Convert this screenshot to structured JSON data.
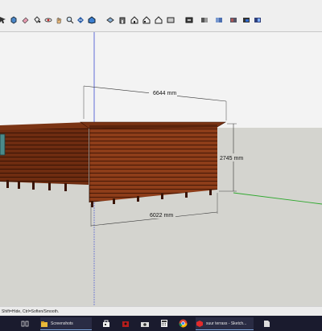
{
  "toolbar": {
    "buttons": [
      {
        "icon": "select-arrow-icon"
      },
      {
        "icon": "component-icon"
      },
      {
        "icon": "eraser-icon"
      },
      {
        "icon": "paint-bucket-icon"
      },
      {
        "icon": "orbit-icon"
      },
      {
        "icon": "pan-icon"
      },
      {
        "icon": "zoom-icon"
      },
      {
        "icon": "zoom-extents-icon"
      },
      {
        "icon": "iso-view-icon"
      },
      {
        "icon": "top-view-icon"
      },
      {
        "icon": "front-view-icon"
      },
      {
        "icon": "right-view-icon"
      },
      {
        "icon": "back-view-icon"
      },
      {
        "icon": "left-view-icon"
      },
      {
        "icon": "xray-icon"
      },
      {
        "icon": "wireframe-icon"
      },
      {
        "icon": "hidden-line-icon"
      },
      {
        "icon": "shaded-icon"
      },
      {
        "icon": "shaded-texture-icon"
      },
      {
        "icon": "monochrome-icon"
      }
    ]
  },
  "viewport": {
    "dimensions": {
      "top_width": "6644 mm",
      "height": "2745 mm",
      "bottom_width": "6022 mm"
    },
    "colors": {
      "sky": "#f3f3f3",
      "ground": "#d4d4cf",
      "wood": "#8a3a18",
      "roof": "#7a3414",
      "axis_blue": "#3a4bd0",
      "axis_green": "#2ea82e"
    }
  },
  "status_bar": {
    "text": "Shift=Hide, Ctrl=Soften/Smooth."
  },
  "taskbar": {
    "items": [
      {
        "icon": "task-view-icon",
        "label": ""
      },
      {
        "icon": "file-explorer-icon",
        "label": "Screenshots"
      },
      {
        "icon": "store-icon",
        "label": ""
      },
      {
        "icon": "app-icon",
        "label": ""
      },
      {
        "icon": "camera-icon",
        "label": ""
      },
      {
        "icon": "calculator-icon",
        "label": ""
      },
      {
        "icon": "chrome-icon",
        "label": ""
      },
      {
        "icon": "sketchup-icon",
        "label": "suur terrass - Sketch..."
      },
      {
        "icon": "file-icon",
        "label": ""
      }
    ]
  }
}
